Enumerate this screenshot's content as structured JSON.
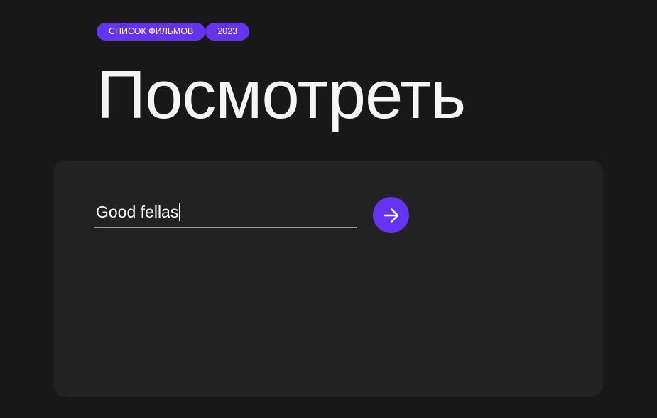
{
  "header": {
    "tags": [
      "СПИСОК ФИЛЬМОВ",
      "2023"
    ],
    "title": "Посмотреть"
  },
  "search": {
    "value": "Good fellas",
    "placeholder": "",
    "submit_icon": "arrow-right-icon"
  },
  "colors": {
    "background": "#181818",
    "panel": "#222222",
    "accent": "#6434f0",
    "text": "#f5f5f5",
    "underline": "#9a9a9a"
  }
}
